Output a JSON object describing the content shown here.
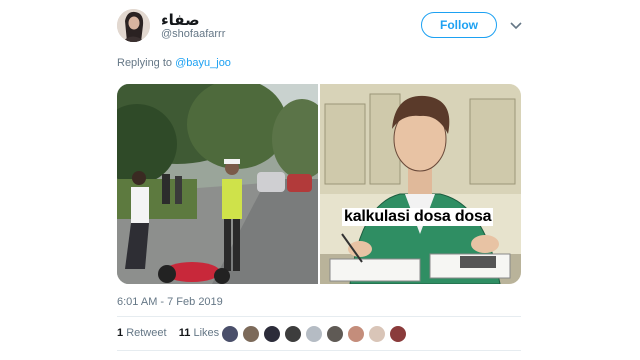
{
  "tweet": {
    "display_name": "صفاء",
    "handle": "@shofaafarrr",
    "follow_label": "Follow",
    "replying_prefix": "Replying to",
    "replying_to": "@bayu_joo",
    "image_caption": "kalkulasi dosa dosa",
    "timestamp": "6:01 AM - 7 Feb 2019",
    "retweets_count": "1",
    "retweets_label": "Retweet",
    "likes_count": "11",
    "likes_label": "Likes"
  },
  "colors": {
    "accent": "#1da1f2",
    "muted_text": "#657786",
    "primary_text": "#14171a"
  },
  "likers_avatars": [
    {
      "color": "#4a4f6a"
    },
    {
      "color": "#7c6a5a"
    },
    {
      "color": "#2c2c3a"
    },
    {
      "color": "#3d3d3d"
    },
    {
      "color": "#b5bcc4"
    },
    {
      "color": "#5f5a55"
    },
    {
      "color": "#c48d7b"
    },
    {
      "color": "#d9c5b8"
    },
    {
      "color": "#8a3b3b"
    }
  ]
}
